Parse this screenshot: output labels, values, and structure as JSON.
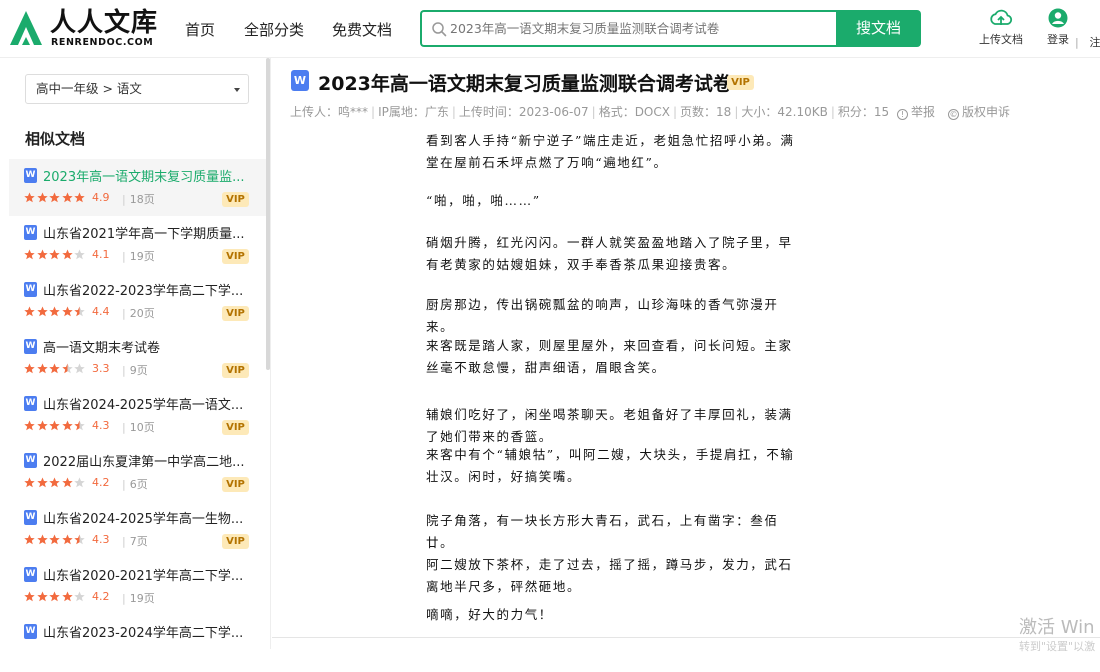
{
  "logo": {
    "title": "人人文库",
    "subtitle": "RENRENDOC.COM"
  },
  "nav": {
    "home": "首页",
    "categories": "全部分类",
    "free_docs": "免费文档"
  },
  "search": {
    "placeholder": "2023年高一语文期末复习质量监测联合调考试卷",
    "button_label": "搜文档"
  },
  "header_tools": {
    "upload_label": "上传文档",
    "login_label": "登录",
    "register_label": "注",
    "separator": "|"
  },
  "sidebar": {
    "category_path": "高中一年级 > 语文",
    "similar_title": "相似文档",
    "items": [
      {
        "name": "2023年高一语文期末复习质量监...",
        "rating": 4.9,
        "score": "4.9",
        "pages": "18页",
        "vip": "VIP",
        "active": true
      },
      {
        "name": "山东省2021学年高一下学期质量...",
        "rating": 4.1,
        "score": "4.1",
        "pages": "19页",
        "vip": "VIP"
      },
      {
        "name": "山东省2022-2023学年高二下学...",
        "rating": 4.4,
        "score": "4.4",
        "pages": "20页",
        "vip": "VIP"
      },
      {
        "name": "高一语文期末考试卷",
        "rating": 3.3,
        "score": "3.3",
        "pages": "9页",
        "vip": "VIP"
      },
      {
        "name": "山东省2024-2025学年高一语文...",
        "rating": 4.3,
        "score": "4.3",
        "pages": "10页",
        "vip": "VIP"
      },
      {
        "name": "2022届山东夏津第一中学高二地...",
        "rating": 4.2,
        "score": "4.2",
        "pages": "6页",
        "vip": "VIP"
      },
      {
        "name": "山东省2024-2025学年高一生物...",
        "rating": 4.3,
        "score": "4.3",
        "pages": "7页",
        "vip": "VIP"
      },
      {
        "name": "山东省2020-2021学年高二下学...",
        "rating": 4.2,
        "score": "4.2",
        "pages": "19页",
        "vip": ""
      },
      {
        "name": "山东省2023-2024学年高二下学...",
        "rating": 0,
        "score": "",
        "pages": "",
        "vip": ""
      }
    ]
  },
  "document": {
    "title": "2023年高一语文期末复习质量监测联合调考试卷",
    "vip": "VIP",
    "meta": {
      "uploader": "上传人：鸣***",
      "ip": "IP属地：广东",
      "upload_time": "上传时间：2023-06-07",
      "format": "格式：DOCX",
      "pages": "页数：18",
      "size": "大小：42.10KB",
      "points": "积分：15"
    },
    "report_label": "举报",
    "copyright_label": "版权申诉",
    "paragraphs": [
      "看到客人手持“新宁逆子”端庄走近，老姐急忙招呼小弟。满堂在屋前石禾坪点燃了万响“遍地红”。",
      "“啪，啪，啪……”",
      "硝烟升腾，红光闪闪。一群人就笑盈盈地踏入了院子里，早有老黄家的姑嫂姐妹，双手奉香茶瓜果迎接贵客。",
      "厨房那边，传出锅碗瓢盆的响声，山珍海味的香气弥漫开来。",
      "来客既是踏人家，则屋里屋外，来回查看，问长问短。主家丝毫不敢怠慢，甜声细语，眉眼含笑。",
      "辅娘们吃好了，闲坐喝茶聊天。老姐备好了丰厚回礼，装满了她们带来的香篮。",
      "来客中有个“辅娘牯”，叫阿二嫂，大块头，手提肩扛，不输壮汉。闲时，好搞笑嘴。",
      "院子角落，有一块长方形大青石，武石，上有凿字：叁佰廿。",
      "阿二嫂放下茶杯，走了过去，摇了摇，蹲马步，发力，武石离地半尺多，砰然砸地。",
      "嘀嘀，好大的力气！"
    ]
  },
  "watermark": {
    "line1": "激活 Win",
    "line2": "转到\"设置\"以激"
  },
  "colors": {
    "brand": "#1bab6c",
    "star": "#f26a3e",
    "doc_icon": "#4c7df0",
    "vip_bg": "#fde9b8"
  }
}
